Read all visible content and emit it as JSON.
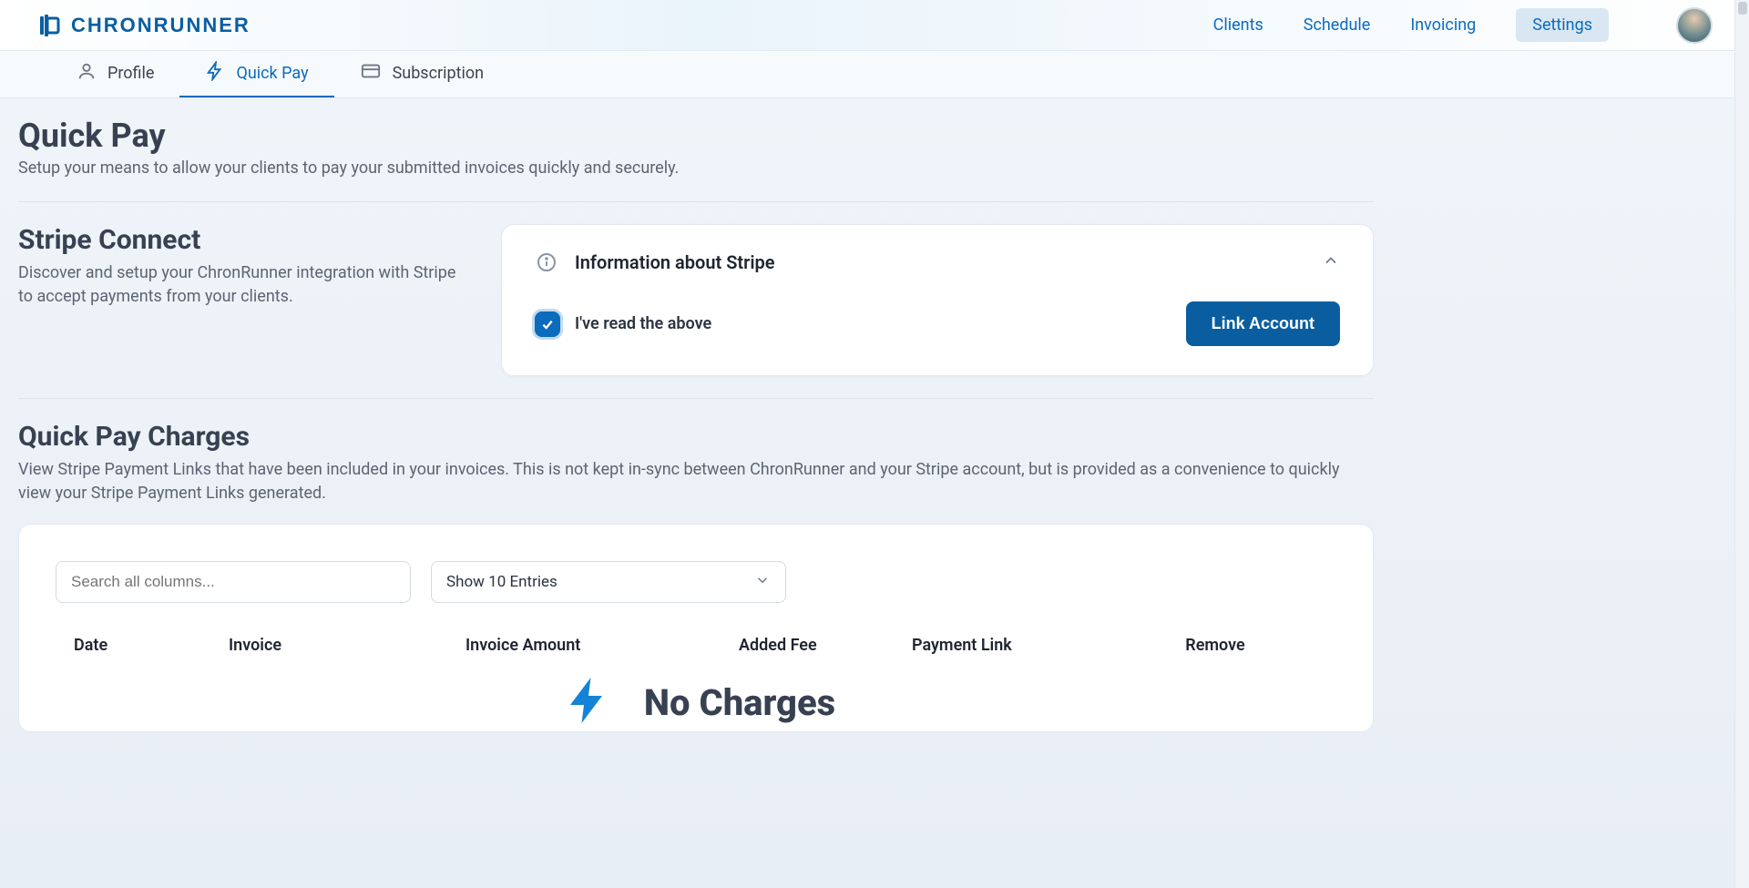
{
  "brand": {
    "name": "CHRONRUNNER"
  },
  "nav": {
    "items": [
      {
        "label": "Clients"
      },
      {
        "label": "Schedule"
      },
      {
        "label": "Invoicing"
      },
      {
        "label": "Settings",
        "active": true
      }
    ]
  },
  "tabs": {
    "items": [
      {
        "label": "Profile",
        "icon": "user-icon"
      },
      {
        "label": "Quick Pay",
        "icon": "bolt-icon",
        "active": true
      },
      {
        "label": "Subscription",
        "icon": "card-icon"
      }
    ]
  },
  "page": {
    "title": "Quick Pay",
    "subtitle": "Setup your means to allow your clients to pay your submitted invoices quickly and securely."
  },
  "stripe": {
    "title": "Stripe Connect",
    "desc": "Discover and setup your ChronRunner integration with Stripe to accept payments from your clients.",
    "info_title": "Information about Stripe",
    "ack_label": "I've read the above",
    "link_button": "Link Account"
  },
  "charges": {
    "title": "Quick Pay Charges",
    "desc": "View Stripe Payment Links that have been included in your invoices. This is not kept in-sync between ChronRunner and your Stripe account, but is provided as a convenience to quickly view your Stripe Payment Links generated.",
    "search_placeholder": "Search all columns...",
    "page_size_label": "Show 10 Entries",
    "columns": {
      "date": "Date",
      "invoice": "Invoice",
      "invoice_amount": "Invoice Amount",
      "added_fee": "Added Fee",
      "payment_link": "Payment Link",
      "remove": "Remove"
    },
    "empty_title": "No Charges"
  }
}
